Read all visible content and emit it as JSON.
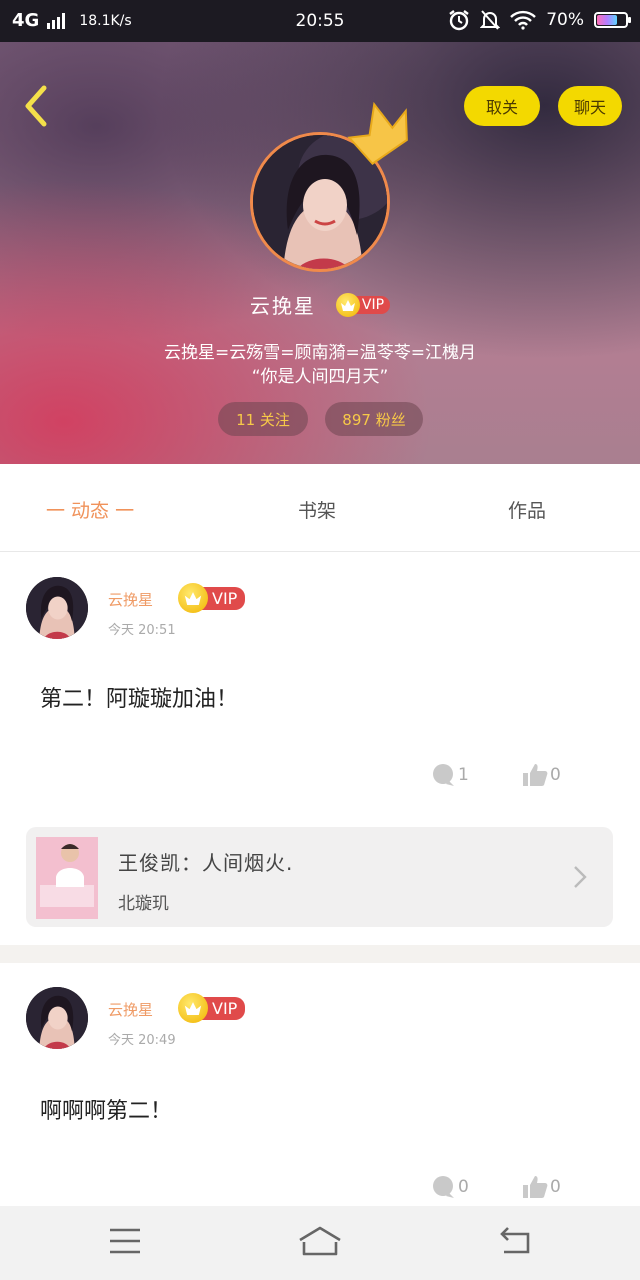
{
  "status_bar": {
    "network": "4G",
    "speed": "18.1K/s",
    "time": "20:55",
    "battery": "70%",
    "battery_level": 0.7
  },
  "profile": {
    "unfollow_label": "取关",
    "chat_label": "聊天",
    "nickname": "云挽星",
    "vip_label": "VIP",
    "bio_line1": "云挽星=云殇雪=顾南漪=温苓苓=江槐月",
    "bio_line2": "“你是人间四月天”",
    "following": "11 关注",
    "fans": "897 粉丝"
  },
  "tabs": [
    {
      "label": "一  动态  一",
      "active": true
    },
    {
      "label": "书架",
      "active": false
    },
    {
      "label": "作品",
      "active": false
    }
  ],
  "posts": [
    {
      "author": "云挽星",
      "vip": "VIP",
      "time": "今天 20:51",
      "content": "第二！阿璇璇加油！",
      "comments": "1",
      "likes": "0",
      "book": {
        "title": "王俊凯：人间烟火.",
        "author": "北璇玑"
      }
    },
    {
      "author": "云挽星",
      "vip": "VIP",
      "time": "今天 20:49",
      "content": "啊啊啊第二！",
      "comments": "0",
      "likes": "0"
    }
  ],
  "colors": {
    "accent_orange": "#f0925a",
    "button_yellow": "#f3d900",
    "vip_red": "#e04a4a"
  }
}
